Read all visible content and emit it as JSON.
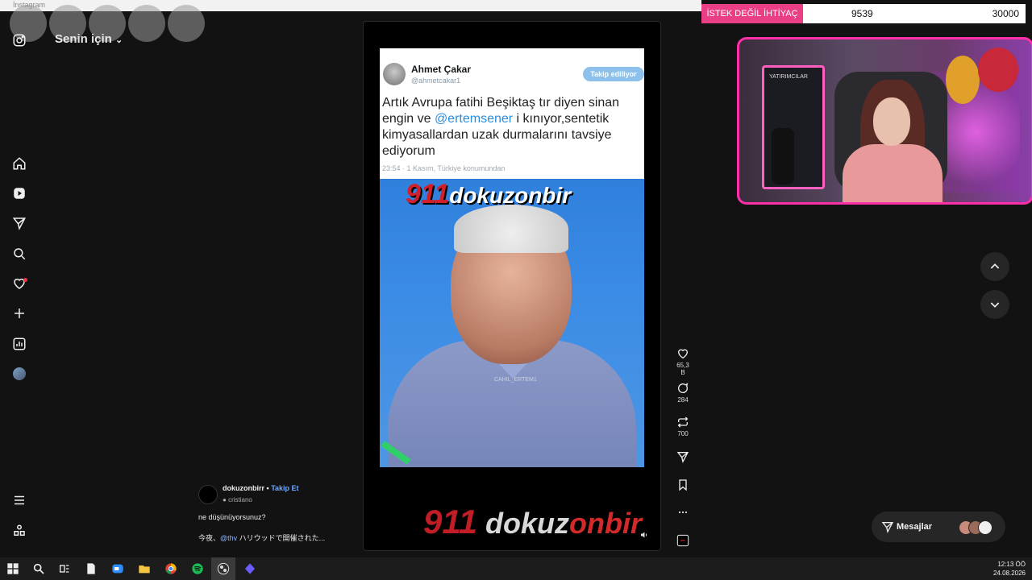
{
  "window": {
    "title_strip": "İnstagram"
  },
  "feed": {
    "title": "Senin için"
  },
  "reel": {
    "tweet": {
      "name": "Ahmet Çakar",
      "handle": "@ahmetcakar1",
      "follow_label": "Takip ediliyor",
      "text_before": "Artık Avrupa fatihi Beşiktaş tır diyen sinan engin ve ",
      "mention": "@ertemsener",
      "text_after": " i kınıyor,sentetik kimyasallardan uzak durmalarını tavsiye ediyorum",
      "meta": "23:54 · 1 Kasım, Türkiye konumundan"
    },
    "video_logo_num": "911",
    "video_logo_text": "dokuzonbir",
    "watermark": "CAHIL_ERTEM1",
    "bottom_logo_num": "911",
    "bottom_logo_a": "dokuz",
    "bottom_logo_b": "onbir"
  },
  "actions": {
    "likes": "65,3 B",
    "comments": "284",
    "reposts": "700"
  },
  "post_info": {
    "username": "dokuzonbirr",
    "separator": "•",
    "follow": "Takip Et",
    "audio": "cristiano",
    "caption": "ne düşünüyorsunuz?",
    "second_prefix": "今夜、",
    "second_mention": "@thv",
    "second_suffix": " ハリウッドで開催された..."
  },
  "goal": {
    "label": "İSTEK DEĞİL İHTİYAÇ",
    "current": "9539",
    "target": "30000"
  },
  "webcam": {
    "board_text": "YATIRIMCILAR"
  },
  "messages": {
    "label": "Mesajlar"
  },
  "taskbar": {
    "time": "12:13 ÖÖ",
    "date": "24.08.2026"
  },
  "colors": {
    "accent_pink": "#ff2fa8",
    "goal_pink": "#ea3f84",
    "link_blue": "#6ea8ff"
  }
}
